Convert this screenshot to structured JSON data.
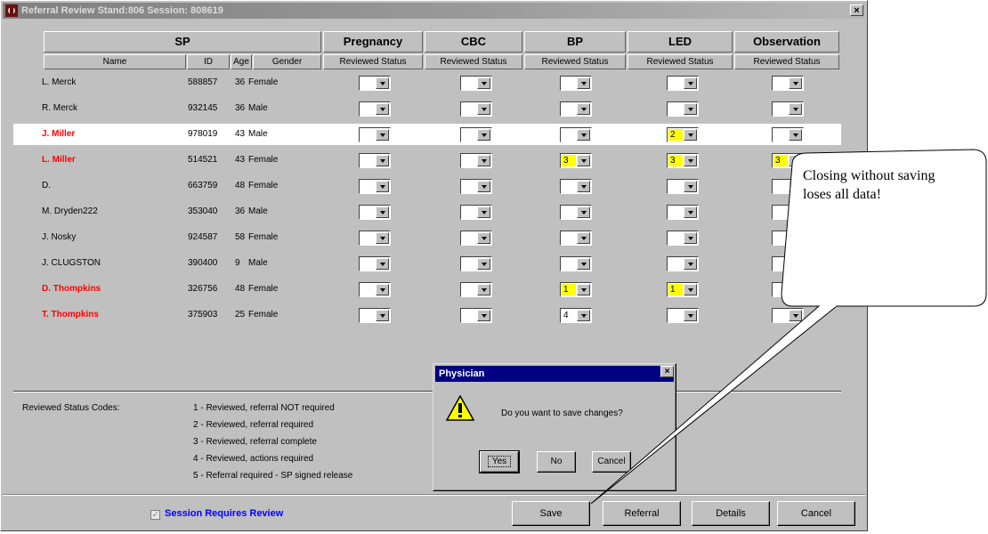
{
  "window": {
    "title": "Referral Review Stand:806 Session: 808619",
    "close_glyph": "×"
  },
  "groups": [
    {
      "label": "SP"
    },
    {
      "label": "Pregnancy"
    },
    {
      "label": "CBC"
    },
    {
      "label": "BP"
    },
    {
      "label": "LED"
    },
    {
      "label": "Observation"
    }
  ],
  "columns": {
    "name": "Name",
    "id": "ID",
    "age": "Age",
    "gender": "Gender",
    "reviewed_status": "Reviewed Status"
  },
  "rows": [
    {
      "name": "L. Merck",
      "id": "588857",
      "age": "36",
      "gender": "Female",
      "red": false,
      "selected": false,
      "statuses": [
        "",
        "",
        "",
        "",
        ""
      ]
    },
    {
      "name": "R. Merck",
      "id": "932145",
      "age": "36",
      "gender": "Male",
      "red": false,
      "selected": false,
      "statuses": [
        "",
        "",
        "",
        "",
        ""
      ]
    },
    {
      "name": "J. Miller",
      "id": "978019",
      "age": "43",
      "gender": "Male",
      "red": true,
      "selected": true,
      "statuses": [
        "",
        "",
        "",
        "2",
        ""
      ]
    },
    {
      "name": "L. Miller",
      "id": "514521",
      "age": "43",
      "gender": "Female",
      "red": true,
      "selected": false,
      "statuses": [
        "",
        "",
        "3",
        "3",
        "3"
      ]
    },
    {
      "name": "D.",
      "id": "663759",
      "age": "48",
      "gender": "Female",
      "red": false,
      "selected": false,
      "statuses": [
        "",
        "",
        "",
        "",
        ""
      ]
    },
    {
      "name": "M. Dryden222",
      "id": "353040",
      "age": "36",
      "gender": "Male",
      "red": false,
      "selected": false,
      "statuses": [
        "",
        "",
        "",
        "",
        ""
      ]
    },
    {
      "name": "J. Nosky",
      "id": "924587",
      "age": "58",
      "gender": "Female",
      "red": false,
      "selected": false,
      "statuses": [
        "",
        "",
        "",
        "",
        ""
      ]
    },
    {
      "name": "J. CLUGSTON",
      "id": "390400",
      "age": "9",
      "gender": "Male",
      "red": false,
      "selected": false,
      "statuses": [
        "",
        "",
        "",
        "",
        ""
      ]
    },
    {
      "name": "D. Thompkins",
      "id": "326756",
      "age": "48",
      "gender": "Female",
      "red": true,
      "selected": false,
      "statuses": [
        "",
        "",
        "1",
        "1",
        ""
      ]
    },
    {
      "name": "T. Thompkins",
      "id": "375903",
      "age": "25",
      "gender": "Female",
      "red": true,
      "selected": false,
      "statuses": [
        "",
        "",
        "4",
        "",
        ""
      ]
    }
  ],
  "codes": {
    "label": "Reviewed Status Codes:",
    "items": [
      "1 - Reviewed, referral NOT required",
      "2 - Reviewed, referral required",
      "3 - Reviewed, referral complete",
      "4 - Reviewed, actions required",
      "5 - Referral required - SP signed release"
    ]
  },
  "footer": {
    "checkbox_label": "Session Requires Review",
    "checkbox_checked": true,
    "buttons": {
      "save": "Save",
      "referral": "Referral",
      "details": "Details",
      "cancel": "Cancel"
    }
  },
  "dialog": {
    "title": "Physician",
    "close_glyph": "×",
    "message": "Do you want to save changes?",
    "buttons": {
      "yes": "Yes",
      "no": "No",
      "cancel": "Cancel"
    }
  },
  "callout": {
    "text": "Closing without saving loses all data!"
  },
  "icons": {
    "warning": "warning-icon",
    "dropdown": "chevron-down-icon",
    "app": "app-icon"
  },
  "colors": {
    "title_bar": "#808080",
    "dialog_title": "#000080",
    "flag_red": "#ff0000",
    "status_yellow": "#ffff00",
    "link_blue": "#0000ff"
  }
}
